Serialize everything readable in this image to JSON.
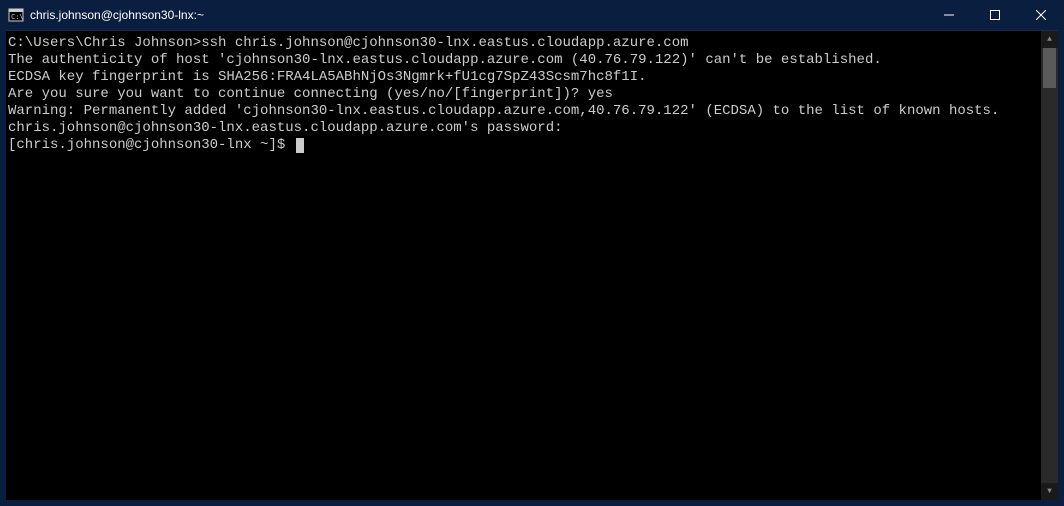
{
  "window": {
    "title": "chris.johnson@cjohnson30-lnx:~"
  },
  "terminal": {
    "lines": [
      "",
      "C:\\Users\\Chris Johnson>ssh chris.johnson@cjohnson30-lnx.eastus.cloudapp.azure.com",
      "The authenticity of host 'cjohnson30-lnx.eastus.cloudapp.azure.com (40.76.79.122)' can't be established.",
      "ECDSA key fingerprint is SHA256:FRA4LA5ABhNjOs3Ngmrk+fU1cg7SpZ43Scsm7hc8f1I.",
      "Are you sure you want to continue connecting (yes/no/[fingerprint])? yes",
      "Warning: Permanently added 'cjohnson30-lnx.eastus.cloudapp.azure.com,40.76.79.122' (ECDSA) to the list of known hosts.",
      "chris.johnson@cjohnson30-lnx.eastus.cloudapp.azure.com's password:",
      "[chris.johnson@cjohnson30-lnx ~]$ "
    ]
  }
}
